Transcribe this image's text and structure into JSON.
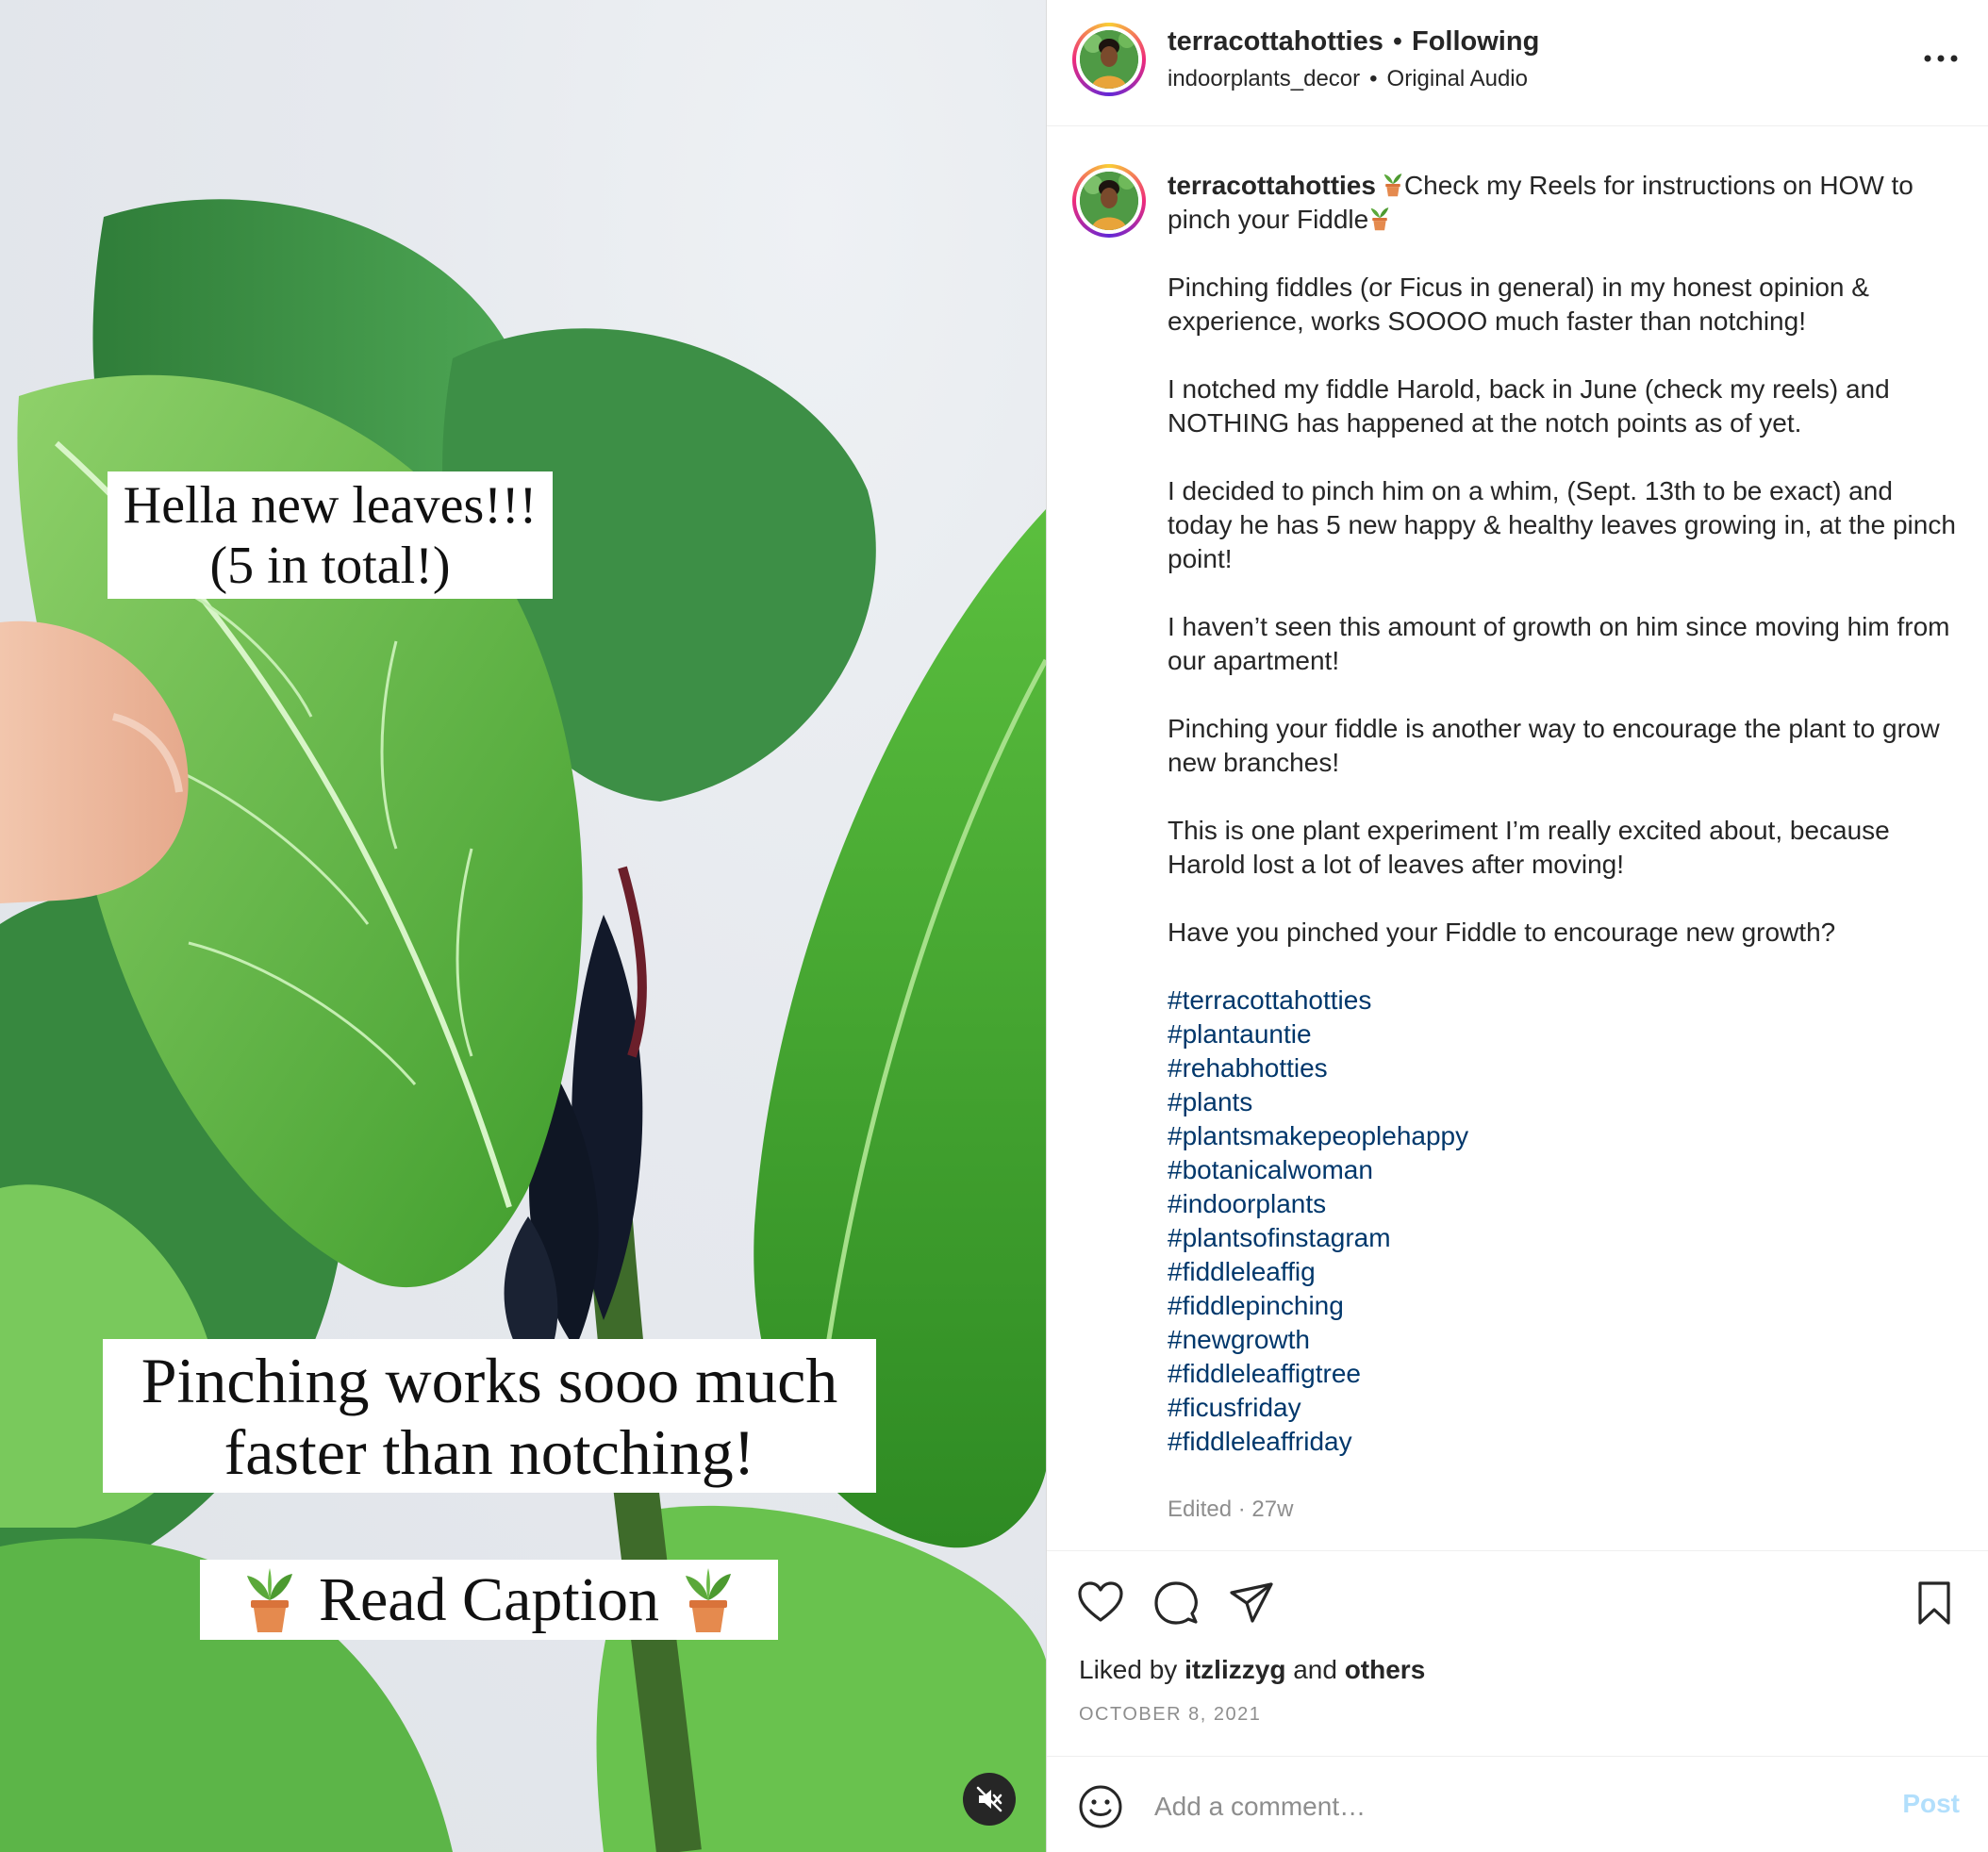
{
  "media": {
    "overlay_top_line1": "Hella new leaves!!!",
    "overlay_top_line2": "(5 in total!)",
    "overlay_mid_line1": "Pinching works sooo much",
    "overlay_mid_line2": "faster than notching!",
    "overlay_bottom": "Read Caption",
    "mute_icon": "muted-speaker-icon"
  },
  "header": {
    "username": "terracottahotties",
    "separator": "•",
    "following_label": "Following",
    "sub_account": "indoorplants_decor",
    "audio_label": "Original Audio",
    "more_icon": "more-options-icon"
  },
  "caption": {
    "username": "terracottahotties",
    "intro": "Check my Reels for instructions on HOW to pinch your Fiddle",
    "paragraphs": [
      "Pinching fiddles (or Ficus in general) in my honest opinion & experience, works SOOOO much faster than notching!",
      "I notched my fiddle Harold, back in June (check my reels) and NOTHING has happened at the notch points as of yet.",
      "I decided to pinch him on a whim, (Sept. 13th to be exact) and today he has 5 new happy & healthy leaves growing in, at the pinch point!",
      "I haven’t seen this amount of growth on him since moving him from our apartment!",
      "Pinching your fiddle is another way to encourage the plant to grow new branches!",
      "This is one plant experiment I’m really excited about, because Harold lost a lot of leaves after moving!",
      "Have you pinched your Fiddle to encourage new growth?"
    ],
    "hashtags": [
      "#terracottahotties",
      "#plantauntie",
      "#rehabhotties",
      "#plants",
      "#plantsmakepeoplehappy",
      "#botanicalwoman",
      "#indoorplants",
      "#plantsofinstagram",
      "#fiddleleaffig",
      "#fiddlepinching",
      "#newgrowth",
      "#fiddleleaffigtree",
      "#ficusfriday",
      "#fiddleleaffriday"
    ],
    "edited_label": "Edited · 27w"
  },
  "actions": {
    "icons": [
      "heart-icon",
      "comment-icon",
      "share-icon",
      "bookmark-icon"
    ],
    "liked_prefix": "Liked by",
    "liked_user": "itzlizzyg",
    "liked_and": "and",
    "liked_others": "others",
    "date": "OCTOBER 8, 2021"
  },
  "comment": {
    "placeholder": "Add a comment…",
    "post_label": "Post",
    "emoji_icon": "emoji-smile-icon"
  },
  "colors": {
    "hashtag": "#00376b",
    "muted_text": "#8e8e8e",
    "post_button_disabled": "#b2dffc",
    "leaf_green": "#4caf3a"
  }
}
